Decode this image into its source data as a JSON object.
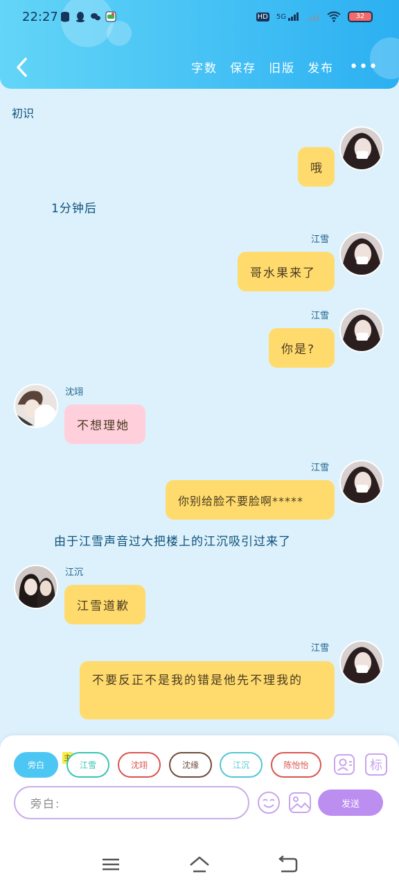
{
  "status_bar": {
    "time": "22:27",
    "network": "5G",
    "hd": "HD",
    "battery": "32"
  },
  "header": {
    "actions": [
      {
        "label": "字数"
      },
      {
        "label": "保存"
      },
      {
        "label": "旧版"
      },
      {
        "label": "发布"
      }
    ]
  },
  "chat": {
    "title": "初识",
    "messages": [
      {
        "type": "bubble",
        "side": "right",
        "name": "",
        "text": "哦",
        "color": "yellow"
      },
      {
        "type": "narration",
        "text": "1分钟后"
      },
      {
        "type": "bubble",
        "side": "right",
        "name": "江雪",
        "text": "哥水果来了",
        "color": "yellow"
      },
      {
        "type": "bubble",
        "side": "right",
        "name": "江雪",
        "text": "你是?",
        "color": "yellow"
      },
      {
        "type": "bubble",
        "side": "left",
        "name": "沈翊",
        "text": "不想理她",
        "color": "pink"
      },
      {
        "type": "bubble",
        "side": "right",
        "name": "江雪",
        "text": "你别给脸不要脸啊*****",
        "color": "yellow"
      },
      {
        "type": "narration",
        "text": "由于江雪声音过大把楼上的江沉吸引过来了"
      },
      {
        "type": "bubble",
        "side": "left",
        "name": "江沉",
        "text": "江雪道歉",
        "color": "yellow"
      },
      {
        "type": "bubble",
        "side": "right",
        "name": "江雪",
        "text": "不要反正不是我的错是他先不理我的",
        "color": "yellow"
      }
    ]
  },
  "composer": {
    "main_badge": "主",
    "characters": [
      {
        "label": "旁白",
        "active": true,
        "color": "#4cc6f2"
      },
      {
        "label": "江雪",
        "active": false,
        "color": "#38c3b2"
      },
      {
        "label": "沈翊",
        "active": false,
        "color": "#d9534f"
      },
      {
        "label": "沈缘",
        "active": false,
        "color": "#6e4a3c"
      },
      {
        "label": "江沉",
        "active": false,
        "color": "#4fc7d6"
      },
      {
        "label": "陈怡怡",
        "active": false,
        "color": "#d9534f"
      }
    ],
    "character_icon": "person-card-icon",
    "tag_icon_label": "标",
    "input_value": "旁白:",
    "send_label": "发送",
    "emoji_icon": "smiley-icon",
    "image_icon": "picture-icon"
  },
  "colors": {
    "header_start": "#63d5f7",
    "header_end": "#2cb0f2",
    "chat_bg": "#dcf1fb",
    "bubble_yellow": "#ffdb6e",
    "bubble_pink": "#ffcfdc",
    "send": "#bb8ef0"
  }
}
